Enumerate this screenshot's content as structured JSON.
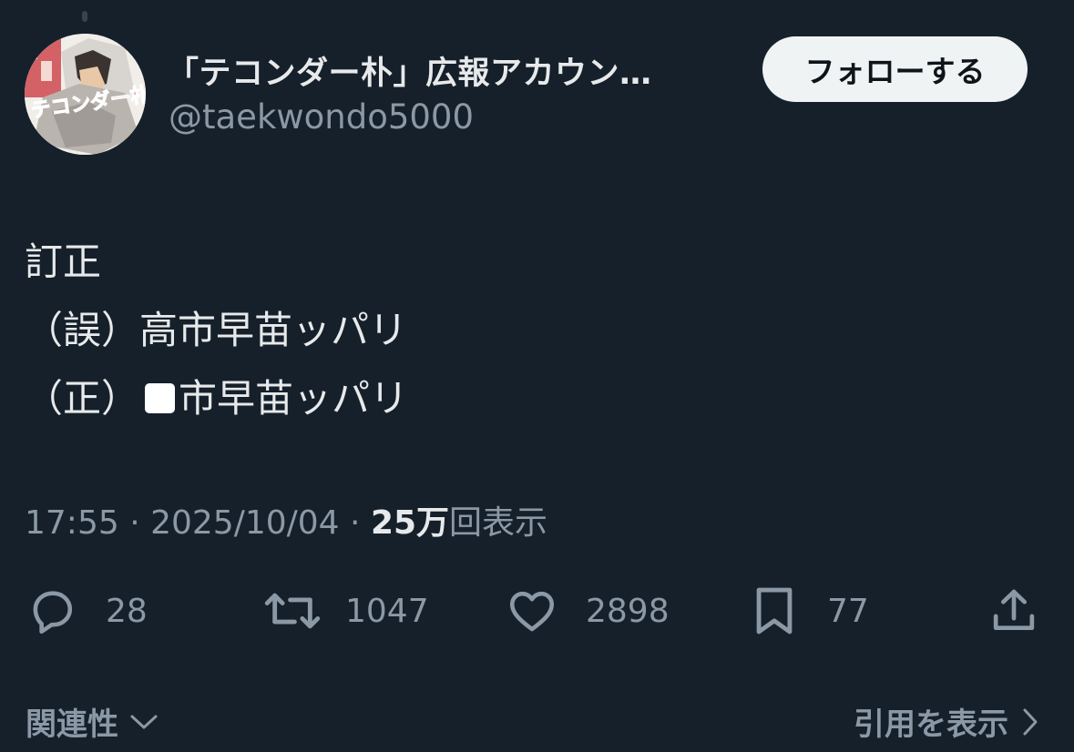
{
  "author": {
    "display_name": "「テコンダー朴」広報アカウン…",
    "handle": "@taekwondo5000",
    "avatar_logo_text": "テコンダー朴"
  },
  "follow_button": {
    "label": "フォローする"
  },
  "tweet": {
    "lines": [
      "訂正",
      "（誤）高市早苗ッパリ",
      "（正）"
    ],
    "line3_after_block": "市早苗ッパリ"
  },
  "meta": {
    "time": "17:55",
    "separator": " · ",
    "date": "2025/10/04",
    "views_count": "25万",
    "views_label": "回表示"
  },
  "actions": {
    "reply": {
      "icon": "reply-icon",
      "count": "28"
    },
    "retweet": {
      "icon": "retweet-icon",
      "count": "1047"
    },
    "like": {
      "icon": "heart-icon",
      "count": "2898"
    },
    "bookmark": {
      "icon": "bookmark-icon",
      "count": "77"
    },
    "share": {
      "icon": "share-icon"
    }
  },
  "footer": {
    "related_label": "関連性",
    "quotes_label": "引用を表示"
  },
  "colors": {
    "background": "#15202b",
    "text_primary": "#e7e9ea",
    "text_secondary": "#8b98a5",
    "follow_button_bg": "#eff3f4"
  }
}
